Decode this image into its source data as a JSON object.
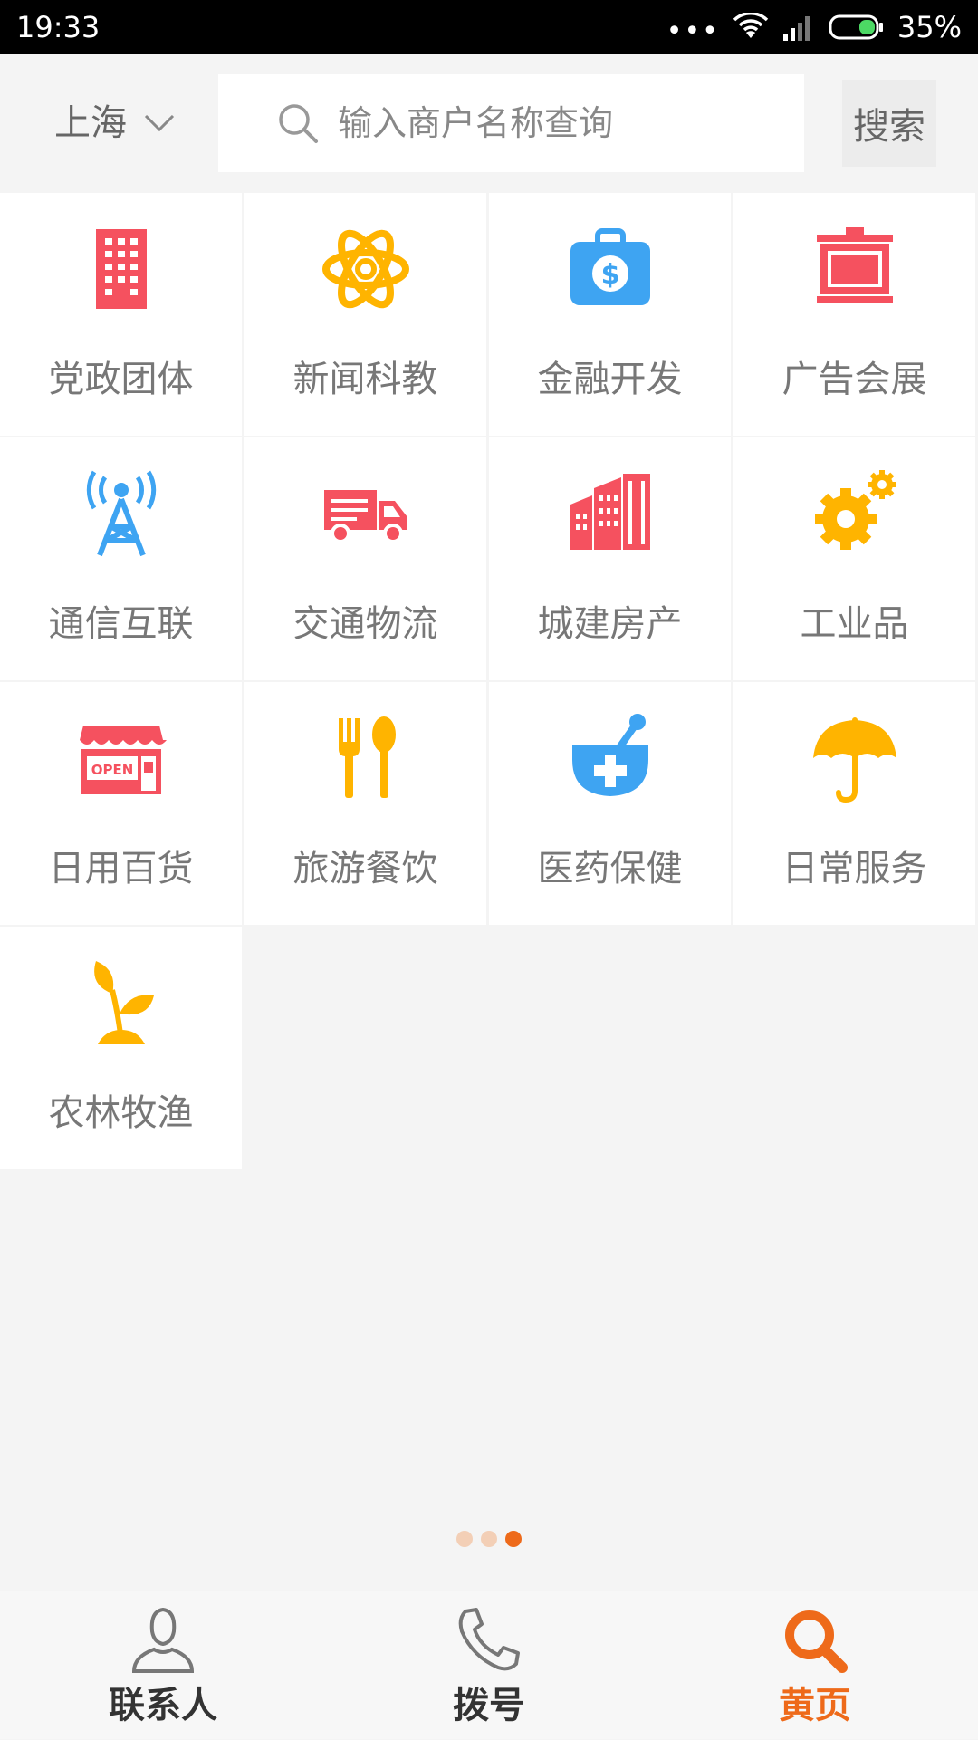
{
  "status_bar": {
    "time": "19:33",
    "dots": "•••",
    "battery_text": "35%"
  },
  "header": {
    "city": "上海",
    "search_placeholder": "输入商户名称查询",
    "search_button": "搜索"
  },
  "categories": [
    {
      "label": "党政团体",
      "icon": "office-building-icon",
      "color": "#f5515f"
    },
    {
      "label": "新闻科教",
      "icon": "atom-icon",
      "color": "#ffb400"
    },
    {
      "label": "金融开发",
      "icon": "money-briefcase-icon",
      "color": "#3ea4f2"
    },
    {
      "label": "广告会展",
      "icon": "billboard-icon",
      "color": "#f5515f"
    },
    {
      "label": "通信互联",
      "icon": "signal-tower-icon",
      "color": "#3ea4f2"
    },
    {
      "label": "交通物流",
      "icon": "delivery-truck-icon",
      "color": "#f5515f"
    },
    {
      "label": "城建房产",
      "icon": "city-buildings-icon",
      "color": "#f5515f"
    },
    {
      "label": "工业品",
      "icon": "gears-icon",
      "color": "#ffb400"
    },
    {
      "label": "日用百货",
      "icon": "open-shop-icon",
      "color": "#f5515f"
    },
    {
      "label": "旅游餐饮",
      "icon": "fork-spoon-icon",
      "color": "#ffb400"
    },
    {
      "label": "医药保健",
      "icon": "medicine-mortar-icon",
      "color": "#3ea4f2"
    },
    {
      "label": "日常服务",
      "icon": "umbrella-icon",
      "color": "#ffb400"
    },
    {
      "label": "农林牧渔",
      "icon": "sprout-icon",
      "color": "#ffb400"
    }
  ],
  "open_sign_text": "OPEN",
  "pager": {
    "total": 3,
    "active": 3
  },
  "bottom_nav": [
    {
      "label": "联系人",
      "icon": "contact-person-icon",
      "active": false
    },
    {
      "label": "拨号",
      "icon": "phone-icon",
      "active": false
    },
    {
      "label": "黄页",
      "icon": "search-icon",
      "active": true
    }
  ],
  "colors": {
    "accent": "#ee6a1a",
    "red": "#f5515f",
    "yellow": "#ffb400",
    "blue": "#3ea4f2"
  }
}
